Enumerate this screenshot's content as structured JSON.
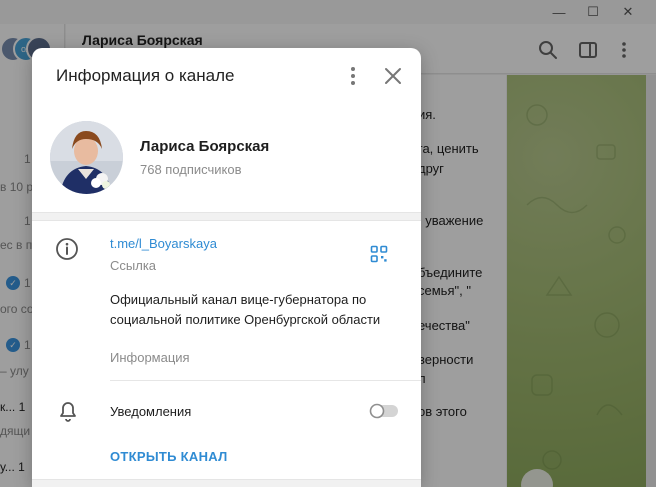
{
  "window": {
    "minimize_glyph": "—",
    "maximize_glyph": "☐",
    "close_glyph": "✕"
  },
  "sidebar": {
    "fragments": [
      {
        "text": "1",
        "style": "gray"
      },
      {
        "text": "в 10 р",
        "style": "gray"
      },
      {
        "text": "1",
        "style": "gray"
      },
      {
        "text": "ес в п",
        "style": "gray"
      },
      {
        "text": "1",
        "style": "gray"
      },
      {
        "text": "ого со",
        "style": "gray"
      },
      {
        "text": "1",
        "style": "gray"
      },
      {
        "text": "– улу",
        "style": "gray"
      },
      {
        "text": "к... 1",
        "style": "dark"
      },
      {
        "text": "дящи",
        "style": "gray"
      },
      {
        "text": "у... 1",
        "style": "dark"
      },
      {
        "text": "ол",
        "style": "white"
      }
    ]
  },
  "chat": {
    "header_title": "Лариса Боярская",
    "message_fragments": [
      "ия.",
      "га, ценить",
      "друг",
      ", уважение",
      "бъедините",
      "семья\", \"",
      "ечества\"",
      "верности",
      "л",
      "ов этого"
    ]
  },
  "dialog": {
    "title": "Информация о канале",
    "channel_name": "Лариса Боярская",
    "subscribers": "768 подписчиков",
    "link": "t.me/l_Boyarskaya",
    "link_label": "Ссылка",
    "description": "Официальный канал вице-губернатора по социальной политике Оренбургской области",
    "description_label": "Информация",
    "notifications_label": "Уведомления",
    "notifications_enabled": false,
    "open_channel_label": "ОТКРЫТЬ КАНАЛ"
  },
  "colors": {
    "accent": "#2f8bd3",
    "muted_text": "#8b8b8b",
    "wallpaper": "#a9bf7a"
  },
  "icons": [
    "more-vertical-icon",
    "close-icon",
    "info-icon",
    "qr-code-icon",
    "bell-icon",
    "search-icon",
    "sidebar-toggle-icon"
  ]
}
